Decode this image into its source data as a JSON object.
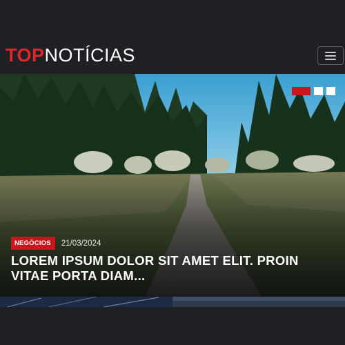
{
  "header": {
    "logo_top": "TOP",
    "logo_rest": "NOTÍCIAS",
    "menu_icon": "hamburger-icon"
  },
  "hero": {
    "category": "NEGÓCIOS",
    "date": "21/03/2024",
    "headline": "LOREM IPSUM DOLOR SIT AMET ELIT. PROIN VITAE PORTA DIAM...",
    "slides_total": 3,
    "active_slide": 1
  },
  "colors": {
    "background": "#1e2024",
    "accent": "#c8161d",
    "logo_accent": "#e0262b",
    "text": "#ffffff"
  }
}
